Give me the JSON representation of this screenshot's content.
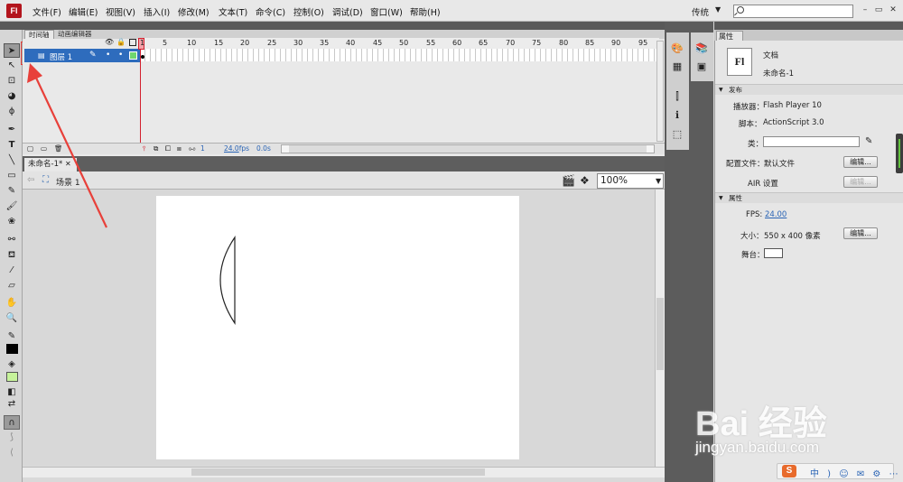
{
  "app": {
    "logo": "Fl",
    "workspace": "传统"
  },
  "menu": [
    "文件(F)",
    "编辑(E)",
    "视图(V)",
    "插入(I)",
    "修改(M)",
    "文本(T)",
    "命令(C)",
    "控制(O)",
    "调试(D)",
    "窗口(W)",
    "帮助(H)"
  ],
  "window_controls": {
    "minimize": "–",
    "restore": "▭",
    "close": "✕"
  },
  "timeline": {
    "tabs": [
      "时间轴",
      "动画编辑器"
    ],
    "ruler": [
      "1",
      "5",
      "10",
      "15",
      "20",
      "25",
      "30",
      "35",
      "40",
      "45",
      "50",
      "55",
      "60",
      "65",
      "70",
      "75",
      "80",
      "85",
      "90",
      "95"
    ],
    "layer": {
      "name": "图层 1"
    },
    "status": {
      "frame": "1",
      "fps": "24.0",
      "fps_unit": "fps",
      "time": "0.0",
      "time_unit": "s"
    }
  },
  "document": {
    "tab_title": "未命名-1*",
    "tab_close": "✕",
    "scene": "场景 1",
    "zoom": "100%"
  },
  "properties": {
    "tab": "属性",
    "doc_type": "文档",
    "doc_name": "未命名-1",
    "publish_section": "发布",
    "player_label": "播放器：",
    "player_value": "Flash Player 10",
    "script_label": "脚本：",
    "script_value": "ActionScript 3.0",
    "class_label": "类：",
    "profile_label": "配置文件：",
    "profile_value": "默认文件",
    "edit_button": "编辑...",
    "air_label": "AIR 设置",
    "air_edit_button": "编辑...",
    "properties_section": "属性",
    "fps_label": "FPS:",
    "fps_value": "24.00",
    "size_label": "大小：",
    "size_value": "550 x 400 像素",
    "size_edit_button": "编辑...",
    "stage_label": "舞台："
  },
  "watermark": {
    "line1": "Bai 经验",
    "line2": "jingyan.baidu.com"
  },
  "tray": {
    "logo": "S",
    "text": "中 ) ☺ ✉ ⚙ ⋯"
  }
}
